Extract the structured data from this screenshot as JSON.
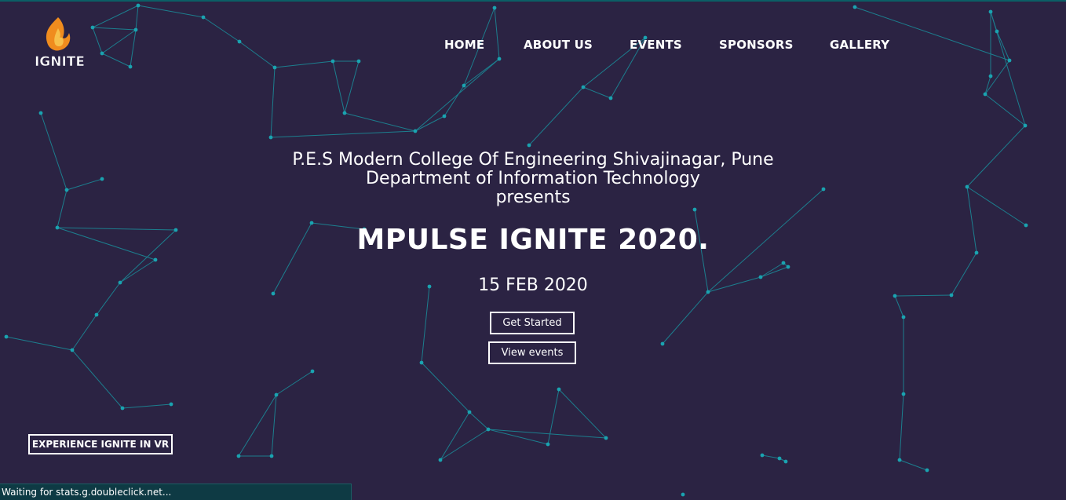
{
  "logo": {
    "text": "IGNITE",
    "icon": "flame-icon",
    "flame_color": "#f08c1e",
    "flame_inner_color": "#f7c04a"
  },
  "nav": {
    "items": [
      {
        "label": "HOME"
      },
      {
        "label": "ABOUT US"
      },
      {
        "label": "EVENTS"
      },
      {
        "label": "SPONSORS"
      },
      {
        "label": "GALLERY"
      }
    ]
  },
  "hero": {
    "college": "P.E.S Modern College Of Engineering Shivajinagar, Pune",
    "department": "Department of Information Technology",
    "presents": "presents",
    "title": "MPULSE IGNITE 2020.",
    "date": "15 FEB 2020",
    "get_started_label": "Get Started",
    "view_events_label": "View events"
  },
  "vr_button": {
    "label": "EXPERIENCE IGNITE IN VR"
  },
  "status_bar": {
    "text": "Waiting for stats.g.doubleclick.net..."
  },
  "colors": {
    "background": "#2b2343",
    "network_node": "#1aa3b0",
    "network_line": "#1a8f9c",
    "status_bar_bg": "#0e3a44"
  }
}
